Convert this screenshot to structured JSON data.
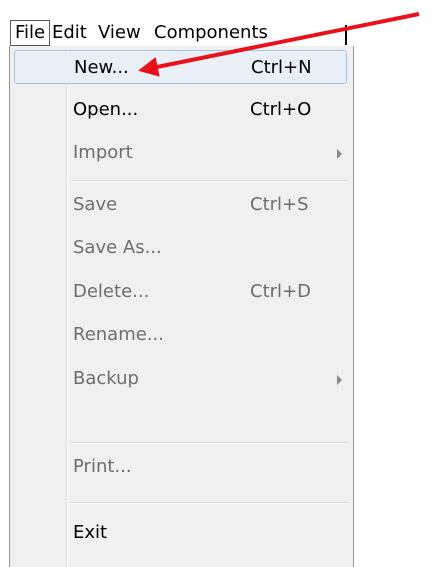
{
  "menubar": {
    "items": [
      "File",
      "Edit",
      "View",
      "Components"
    ]
  },
  "file_menu": {
    "items": [
      {
        "label": "New...",
        "shortcut": "Ctrl+N",
        "enabled": true,
        "highlighted": true
      },
      {
        "label": "Open...",
        "shortcut": "Ctrl+O",
        "enabled": true
      },
      {
        "label": "Import",
        "shortcut": "",
        "enabled": false,
        "submenu": true
      },
      {
        "label": "Save",
        "shortcut": "Ctrl+S",
        "enabled": false
      },
      {
        "label": "Save As...",
        "shortcut": "",
        "enabled": false
      },
      {
        "label": "Delete...",
        "shortcut": "Ctrl+D",
        "enabled": false
      },
      {
        "label": "Rename...",
        "shortcut": "",
        "enabled": false
      },
      {
        "label": "Backup",
        "shortcut": "",
        "enabled": false,
        "submenu": true
      },
      {
        "label": "Print...",
        "shortcut": "",
        "enabled": false
      },
      {
        "label": "Exit",
        "shortcut": "",
        "enabled": true
      }
    ]
  },
  "colors": {
    "highlight_bg": "#e8eff7",
    "highlight_border": "#a8c4e4",
    "disabled_text": "#6d6d6d",
    "annotation_arrow": "#e8111b"
  },
  "icons": {
    "submenu": "submenu-arrow-icon",
    "annotation": "red-arrow-annotation"
  }
}
